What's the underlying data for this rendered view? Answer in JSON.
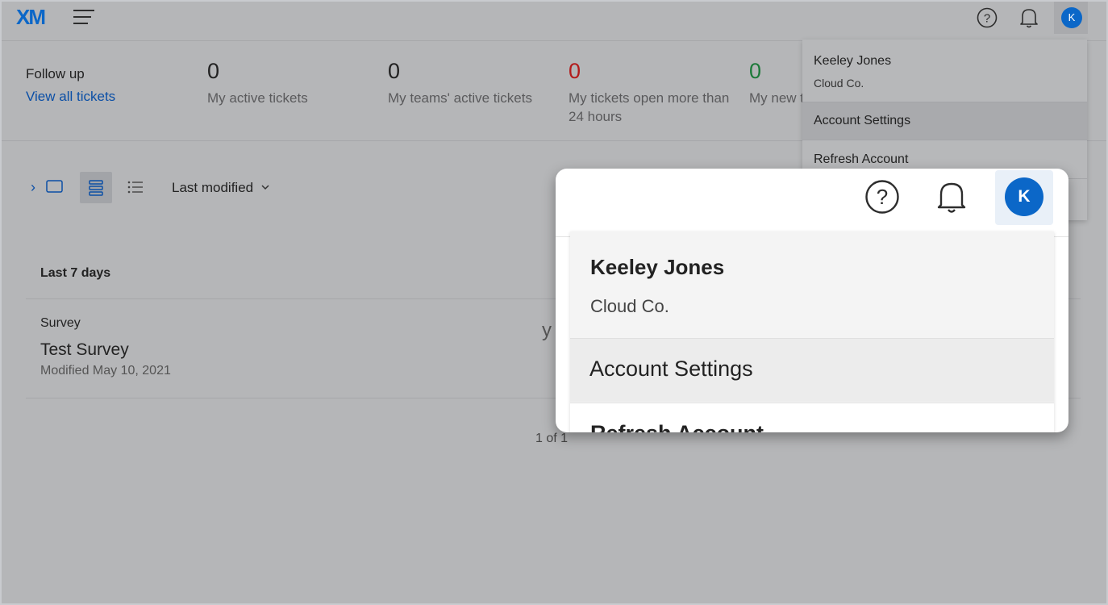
{
  "header": {
    "logo": "XM",
    "avatar_initial": "K"
  },
  "stats": {
    "follow_up": "Follow up",
    "view_all": "View all tickets",
    "items": [
      {
        "value": "0",
        "label": "My active tickets"
      },
      {
        "value": "0",
        "label": "My teams' active tickets"
      },
      {
        "value": "0",
        "label": "My tickets open more than 24 hours"
      },
      {
        "value": "0",
        "label": "My new t"
      }
    ]
  },
  "toolbar": {
    "sort_label": "Last modified"
  },
  "list": {
    "group_label": "Last 7 days",
    "item_type": "Survey",
    "item_name": "Test Survey",
    "item_modified": "Modified May 10, 2021",
    "stray_text": "y t",
    "pager": "1 of 1"
  },
  "account_menu": {
    "name": "Keeley Jones",
    "org": "Cloud Co.",
    "account_settings": "Account Settings",
    "refresh_account": "Refresh Account"
  },
  "zoom": {
    "avatar_initial": "K",
    "name": "Keeley Jones",
    "org": "Cloud Co.",
    "account_settings": "Account Settings",
    "refresh_account_partial": "Refresh Account"
  },
  "colors": {
    "accent": "#0b67c8",
    "link": "#0b4fa6",
    "danger": "#b31b1b",
    "success": "#1d7a3a",
    "overlay": "#b5b6b8"
  }
}
